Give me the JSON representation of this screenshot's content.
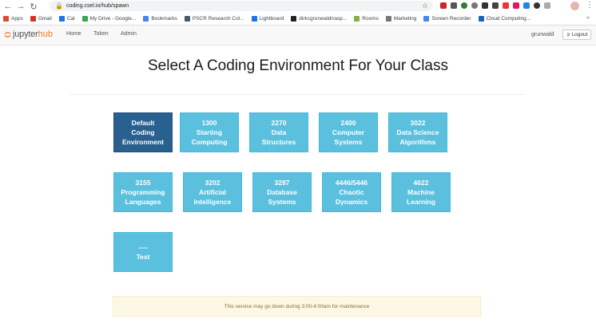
{
  "browser": {
    "url": "coding.csel.io/hub/spawn",
    "bookmarks": [
      {
        "label": "Apps",
        "color": "#ea4335"
      },
      {
        "label": "Gmail",
        "color": "#d93025"
      },
      {
        "label": "Cal",
        "color": "#1a73e8"
      },
      {
        "label": "My Drive - Google...",
        "color": "#34a853"
      },
      {
        "label": "Bookmarks",
        "color": "#4285f4"
      },
      {
        "label": "PSCR Research Col...",
        "color": "#455a64"
      },
      {
        "label": "Lightboard",
        "color": "#1a73e8"
      },
      {
        "label": "dirkcgrunwald/rasp...",
        "color": "#202124"
      },
      {
        "label": "Rooms",
        "color": "#7cb342"
      },
      {
        "label": "Marketing",
        "color": "#757575"
      },
      {
        "label": "Screen Recorder",
        "color": "#4285f4"
      },
      {
        "label": "Cloud Computing...",
        "color": "#1565c0"
      }
    ],
    "more": "»"
  },
  "header": {
    "logo_jupyter": "jupyter",
    "logo_hub": "hub",
    "nav": [
      "Home",
      "Token",
      "Admin"
    ],
    "username": "grunwald",
    "logout_label": "Logout"
  },
  "main": {
    "title": "Select A Coding Environment For Your Class",
    "environments": [
      {
        "lines": [
          "Default",
          "Coding",
          "Environment"
        ],
        "selected": true
      },
      {
        "lines": [
          "1300",
          "Starting",
          "Computing"
        ],
        "selected": false
      },
      {
        "lines": [
          "2270",
          "Data",
          "Structures"
        ],
        "selected": false
      },
      {
        "lines": [
          "2400",
          "Computer",
          "Systems"
        ],
        "selected": false
      },
      {
        "lines": [
          "3022",
          "Data Science",
          "Algorithms"
        ],
        "selected": false
      },
      {
        "lines": [
          "3155",
          "Programming",
          "Languages"
        ],
        "selected": false
      },
      {
        "lines": [
          "3202",
          "Artificial",
          "Intelligence"
        ],
        "selected": false
      },
      {
        "lines": [
          "3287",
          "Database",
          "Systems"
        ],
        "selected": false
      },
      {
        "lines": [
          "4446/5446",
          "Chaotic",
          "Dynamics"
        ],
        "selected": false
      },
      {
        "lines": [
          "4622",
          "Machine",
          "Learning"
        ],
        "selected": false
      },
      {
        "lines": [
          "----",
          "Test"
        ],
        "selected": false
      }
    ],
    "notice": "This service may go down during 3:00-4:00am for maintenance"
  },
  "colors": {
    "env_bg": "#5bc0de",
    "env_selected_bg": "#286090",
    "hub_orange": "#f37726",
    "notice_bg": "#fcf8e3"
  }
}
